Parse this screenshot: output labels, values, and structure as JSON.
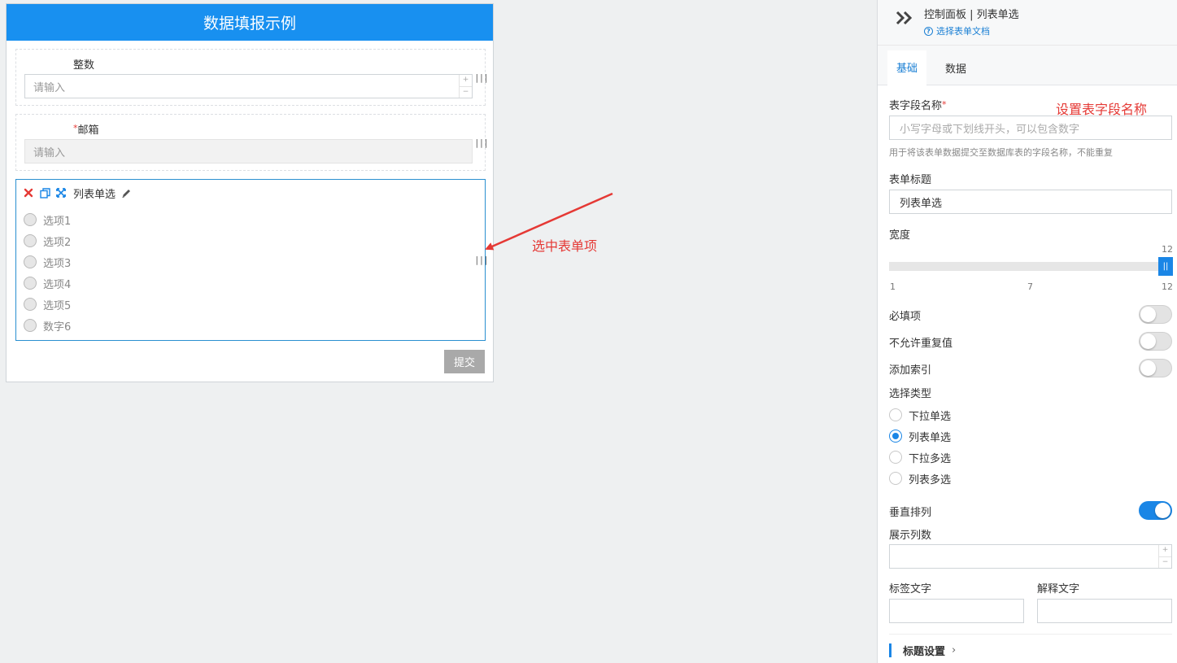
{
  "form": {
    "title": "数据填报示例",
    "fields": {
      "integer": {
        "label": "整数",
        "placeholder": "请输入",
        "step_up": "+",
        "step_down": "−"
      },
      "email": {
        "required_mark": "*",
        "label": "邮箱",
        "placeholder": "请输入"
      },
      "list_single": {
        "title": "列表单选",
        "options": [
          "选项1",
          "选项2",
          "选项3",
          "选项4",
          "选项5",
          "数字6"
        ]
      }
    },
    "drag_handle": "|||",
    "submit_label": "提交"
  },
  "annotations": {
    "select_item": "选中表单项",
    "set_field_name": "设置表字段名称"
  },
  "panel": {
    "title": "控制面板 | 列表单选",
    "doc_link": "选择表单文档",
    "doc_link_icon": "?",
    "tabs": [
      {
        "label": "基础"
      },
      {
        "label": "数据"
      }
    ],
    "field_name": {
      "label": "表字段名称",
      "required_mark": "*",
      "placeholder": "小写字母或下划线开头，可以包含数字",
      "help": "用于将该表单数据提交至数据库表的字段名称，不能重复"
    },
    "form_title": {
      "label": "表单标题",
      "value": "列表单选"
    },
    "width": {
      "label": "宽度",
      "value": 12,
      "min": 1,
      "mid": 7,
      "max": 12,
      "min_label": "1",
      "mid_label": "7",
      "max_label": "12",
      "current_label": "12",
      "handle_glyph": "||"
    },
    "toggles": {
      "required": {
        "label": "必填项",
        "on": false
      },
      "unique": {
        "label": "不允许重复值",
        "on": false
      },
      "index": {
        "label": "添加索引",
        "on": false
      },
      "vertical": {
        "label": "垂直排列",
        "on": true
      }
    },
    "select_type": {
      "label": "选择类型",
      "options": [
        "下拉单选",
        "列表单选",
        "下拉多选",
        "列表多选"
      ],
      "selected": "列表单选"
    },
    "columns": {
      "label": "展示列数",
      "step_up": "+",
      "step_down": "−"
    },
    "tag_text": {
      "label": "标签文字"
    },
    "explain_text": {
      "label": "解释文字"
    },
    "title_settings": {
      "label": "标题设置",
      "chevron": "›"
    }
  },
  "colors": {
    "header_blue": "#1890f0",
    "accent_blue": "#1a86e6",
    "annotation_red": "#e53935"
  }
}
